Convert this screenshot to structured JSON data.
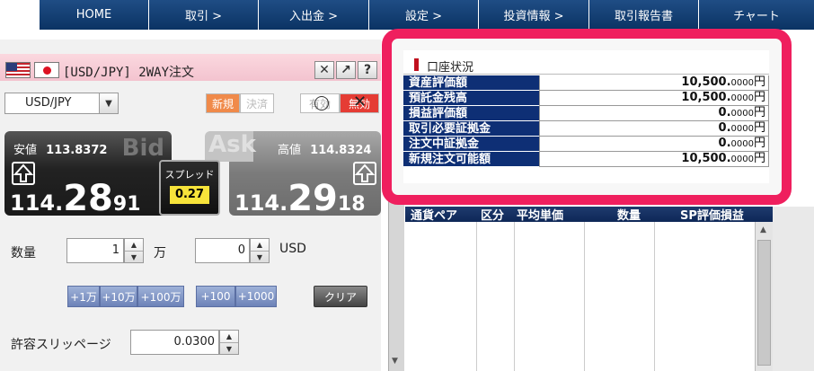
{
  "nav": [
    "HOME",
    "取引 >",
    "入出金 >",
    "設定 >",
    "投資情報 >",
    "取引報告書",
    "チャート"
  ],
  "order_panel": {
    "title": "[USD/JPY] 2WAY注文",
    "pair_select": "USD/JPY",
    "mode_new": "新規",
    "mode_close": "決済",
    "toggle_on": "有効",
    "toggle_off": "無効",
    "bid": {
      "watermark": "Bid",
      "low_label": "安値",
      "low_value": "113.8372",
      "price_big": "114.",
      "price_main": "28",
      "price_small": "91"
    },
    "ask": {
      "watermark": "Ask",
      "high_label": "高値",
      "high_value": "114.8324",
      "price_big": "114.",
      "price_main": "29",
      "price_small": "18"
    },
    "spread_label": "スプレッド",
    "spread_value": "0.27",
    "quantity_label": "数量",
    "quantity_value": "1",
    "quantity_unit": "万",
    "usd_value": "0",
    "usd_unit": "USD",
    "quick_man": [
      "+1万",
      "+10万",
      "+100万"
    ],
    "quick_usd": [
      "+100",
      "+1000"
    ],
    "clear_label": "クリア",
    "slippage_label": "許容スリッページ",
    "slippage_value": "0.0300"
  },
  "account": {
    "title": "口座状況",
    "rows": [
      {
        "label": "資産評価額",
        "int": "10,500.",
        "dec": "0000",
        "unit": "円"
      },
      {
        "label": "預託金残高",
        "int": "10,500.",
        "dec": "0000",
        "unit": "円"
      },
      {
        "label": "損益評価額",
        "int": "0.",
        "dec": "0000",
        "unit": "円"
      },
      {
        "label": "取引必要証拠金",
        "int": "0.",
        "dec": "0000",
        "unit": "円"
      },
      {
        "label": "注文中証拠金",
        "int": "0.",
        "dec": "0000",
        "unit": "円"
      },
      {
        "label": "新規注文可能額",
        "int": "10,500.",
        "dec": "0000",
        "unit": "円"
      }
    ]
  },
  "positions": {
    "headers": [
      "通貨ペア",
      "区分",
      "平均単価",
      "数量",
      "SP評価損益"
    ]
  },
  "colors": {
    "nav_bg": "#0e3a6e",
    "highlight": "#ef1f5e",
    "account_label_bg": "#0e2f75",
    "spread_bg": "#f7e33a",
    "new_btn": "#f08a4a",
    "off_btn": "#e53c34"
  }
}
